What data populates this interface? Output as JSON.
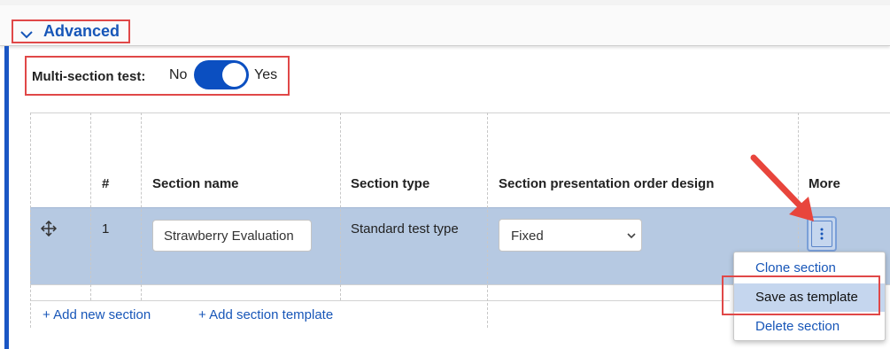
{
  "advanced": {
    "title": "Advanced"
  },
  "multi_section": {
    "label": "Multi-section test:",
    "no": "No",
    "yes": "Yes",
    "enabled": true
  },
  "table": {
    "headers": [
      "#",
      "Section name",
      "Section type",
      "Section presentation order design",
      "More"
    ],
    "rows": [
      {
        "number": "1",
        "name": "Strawberry Evaluation",
        "type": "Standard test type",
        "order_design": "Fixed"
      }
    ]
  },
  "actions": {
    "add_section": "+ Add new section",
    "add_template": "+ Add section template"
  },
  "menu": {
    "items": [
      "Clone section",
      "Save as template",
      "Delete section"
    ],
    "highlighted": "Save as template"
  },
  "colors": {
    "accent": "#1756b8",
    "toggle_on": "#0b4fc1",
    "annotation": "#e04848",
    "row_selected": "#b6c9e2"
  },
  "icons": {
    "expand": "chevron-down-icon",
    "drag": "move-handle-icon",
    "more": "kebab-menu-icon",
    "dropdown": "chevron-down-icon"
  }
}
